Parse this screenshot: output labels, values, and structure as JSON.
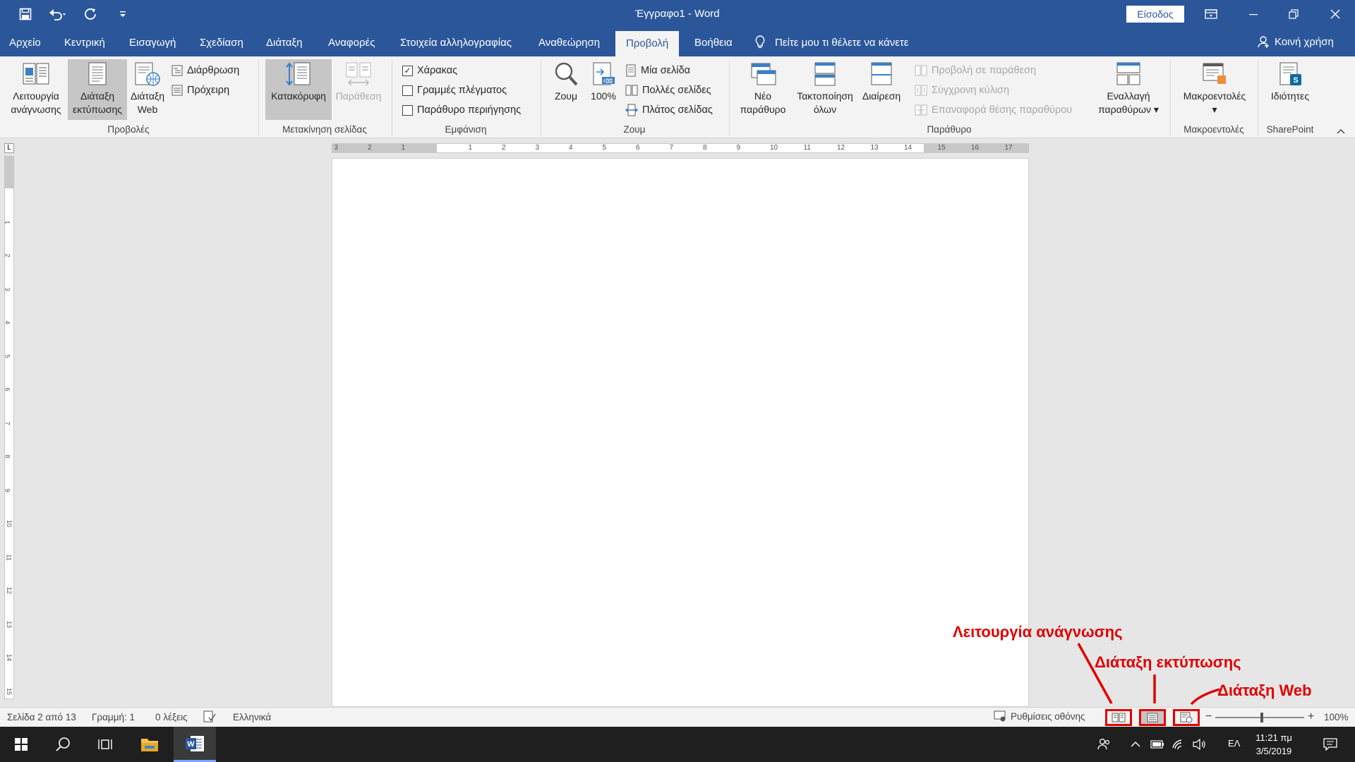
{
  "window": {
    "title": "Έγγραφο1  -  Word",
    "sign_in": "Είσοδος"
  },
  "tabs": [
    "Αρχείο",
    "Κεντρική",
    "Εισαγωγή",
    "Σχεδίαση",
    "Διάταξη",
    "Αναφορές",
    "Στοιχεία αλληλογραφίας",
    "Αναθεώρηση",
    "Προβολή",
    "Βοήθεια"
  ],
  "active_tab": "Προβολή",
  "tell_me": "Πείτε μου τι θέλετε να κάνετε",
  "share": "Κοινή χρήση",
  "ribbon": {
    "views": {
      "label": "Προβολές",
      "read_mode_1": "Λειτουργία",
      "read_mode_2": "ανάγνωσης",
      "print_layout_1": "Διάταξη",
      "print_layout_2": "εκτύπωσης",
      "web_layout_1": "Διάταξη",
      "web_layout_2": "Web",
      "outline": "Διάρθρωση",
      "draft": "Πρόχειρη"
    },
    "page_movement": {
      "label": "Μετακίνηση σελίδας",
      "vertical": "Κατακόρυφη",
      "side_by_side": "Παράθεση"
    },
    "show": {
      "label": "Εμφάνιση",
      "ruler": "Χάρακας",
      "ruler_checked": true,
      "gridlines": "Γραμμές πλέγματος",
      "gridlines_checked": false,
      "nav_pane": "Παράθυρο περιήγησης",
      "nav_pane_checked": false
    },
    "zoom": {
      "label": "Ζουμ",
      "zoom": "Ζουμ",
      "hundred": "100%",
      "one_page": "Μία σελίδα",
      "multiple_pages": "Πολλές σελίδες",
      "page_width": "Πλάτος σελίδας"
    },
    "window": {
      "label": "Παράθυρο",
      "new_window_1": "Νέο",
      "new_window_2": "παράθυρο",
      "arrange_1": "Τακτοποίηση",
      "arrange_2": "όλων",
      "split": "Διαίρεση",
      "side_by_side": "Προβολή σε παράθεση",
      "sync_scroll": "Σύγχρονη κύλιση",
      "reset_pos": "Επαναφορά θέσης παραθύρου",
      "switch_1": "Εναλλαγή",
      "switch_2": "παραθύρων"
    },
    "macros": {
      "label": "Μακροεντολές",
      "button": "Μακροεντολές"
    },
    "sharepoint": {
      "label": "SharePoint",
      "button": "Ιδιότητες"
    }
  },
  "ruler_top": [
    "3",
    "2",
    "1",
    "1",
    "2",
    "3",
    "4",
    "5",
    "6",
    "7",
    "8",
    "9",
    "10",
    "11",
    "12",
    "13",
    "14",
    "15",
    "16",
    "17"
  ],
  "ruler_left": [
    "1",
    "2",
    "3",
    "4",
    "5",
    "6",
    "7",
    "8",
    "9",
    "10",
    "11",
    "12",
    "13",
    "14",
    "15"
  ],
  "status": {
    "page": "Σελίδα 2 από 13",
    "line": "Γραμμή: 1",
    "words": "0 λέξεις",
    "language": "Ελληνικά",
    "display_settings": "Ρυθμίσεις οθόνης",
    "zoom": "100%",
    "zoom_minus": "−",
    "zoom_plus": "+"
  },
  "annotations": {
    "read_mode": "Λειτουργία ανάγνωσης",
    "print_layout": "Διάταξη εκτύπωσης",
    "web_layout": "Διάταξη Web"
  },
  "taskbar": {
    "time": "11:21 πμ",
    "date": "3/5/2019",
    "lang": "ΕΛ"
  },
  "colors": {
    "brand": "#2b579a",
    "annotation": "#e00000"
  }
}
